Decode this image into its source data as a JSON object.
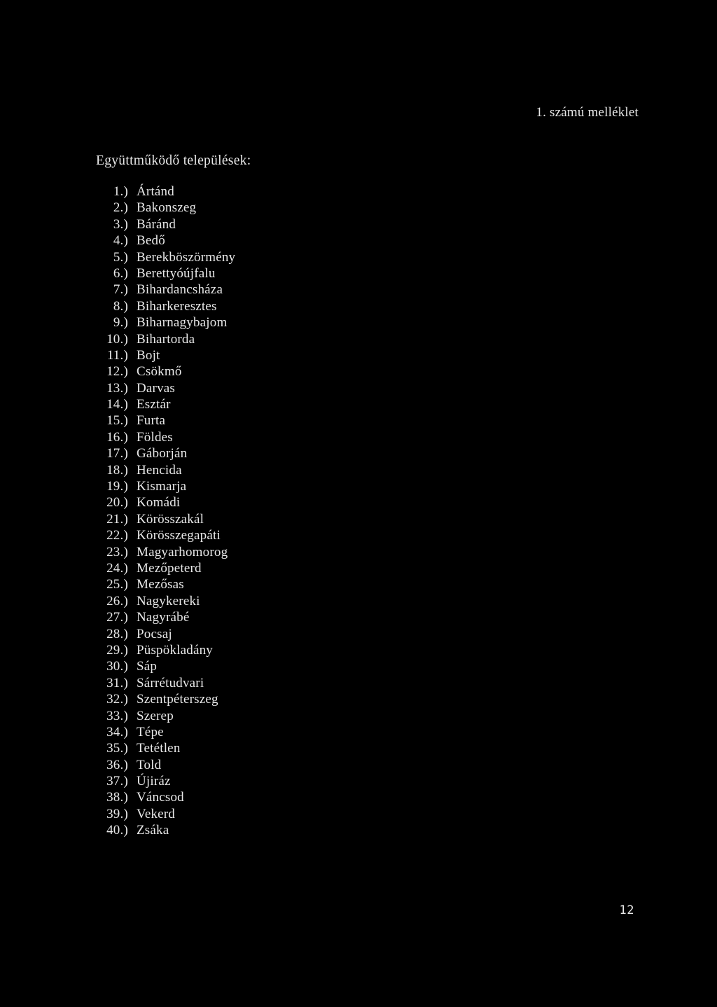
{
  "document": {
    "annex_header": "1. számú melléklet",
    "section_title": "Együttműködő települések:",
    "page_number": "12",
    "background_color": "#000000",
    "text_color": "#e8e8e8"
  },
  "settlements": [
    {
      "number": "1.)",
      "name": "Ártánd"
    },
    {
      "number": "2.)",
      "name": "Bakonszeg"
    },
    {
      "number": "3.)",
      "name": "Báránd"
    },
    {
      "number": "4.)",
      "name": "Bedő"
    },
    {
      "number": "5.)",
      "name": "Berekböszörmény"
    },
    {
      "number": "6.)",
      "name": "Berettyóújfalu"
    },
    {
      "number": "7.)",
      "name": "Bihardancsháza"
    },
    {
      "number": "8.)",
      "name": "Biharkeresztes"
    },
    {
      "number": "9.)",
      "name": "Biharnagybajom"
    },
    {
      "number": "10.)",
      "name": "Bihartorda"
    },
    {
      "number": "11.)",
      "name": "Bojt"
    },
    {
      "number": "12.)",
      "name": "Csökmő"
    },
    {
      "number": "13.)",
      "name": "Darvas"
    },
    {
      "number": "14.)",
      "name": "Esztár"
    },
    {
      "number": "15.)",
      "name": "Furta"
    },
    {
      "number": "16.)",
      "name": "Földes"
    },
    {
      "number": "17.)",
      "name": "Gáborján"
    },
    {
      "number": "18.)",
      "name": "Hencida"
    },
    {
      "number": "19.)",
      "name": "Kismarja"
    },
    {
      "number": "20.)",
      "name": "Komádi"
    },
    {
      "number": "21.)",
      "name": "Körösszakál"
    },
    {
      "number": "22.)",
      "name": "Körösszegapáti"
    },
    {
      "number": "23.)",
      "name": "Magyarhomorog"
    },
    {
      "number": "24.)",
      "name": "Mezőpeterd"
    },
    {
      "number": "25.)",
      "name": "Mezősas"
    },
    {
      "number": "26.)",
      "name": "Nagykereki"
    },
    {
      "number": "27.)",
      "name": "Nagyrábé"
    },
    {
      "number": "28.)",
      "name": "Pocsaj"
    },
    {
      "number": "29.)",
      "name": "Püspökladány"
    },
    {
      "number": "30.)",
      "name": "Sáp"
    },
    {
      "number": "31.)",
      "name": "Sárrétudvari"
    },
    {
      "number": "32.)",
      "name": "Szentpéterszeg"
    },
    {
      "number": "33.)",
      "name": "Szerep"
    },
    {
      "number": "34.)",
      "name": "Tépe"
    },
    {
      "number": "35.)",
      "name": "Tetétlen"
    },
    {
      "number": "36.)",
      "name": "Told"
    },
    {
      "number": "37.)",
      "name": "Újiráz"
    },
    {
      "number": "38.)",
      "name": "Váncsod"
    },
    {
      "number": "39.)",
      "name": "Vekerd"
    },
    {
      "number": "40.)",
      "name": "Zsáka"
    }
  ]
}
